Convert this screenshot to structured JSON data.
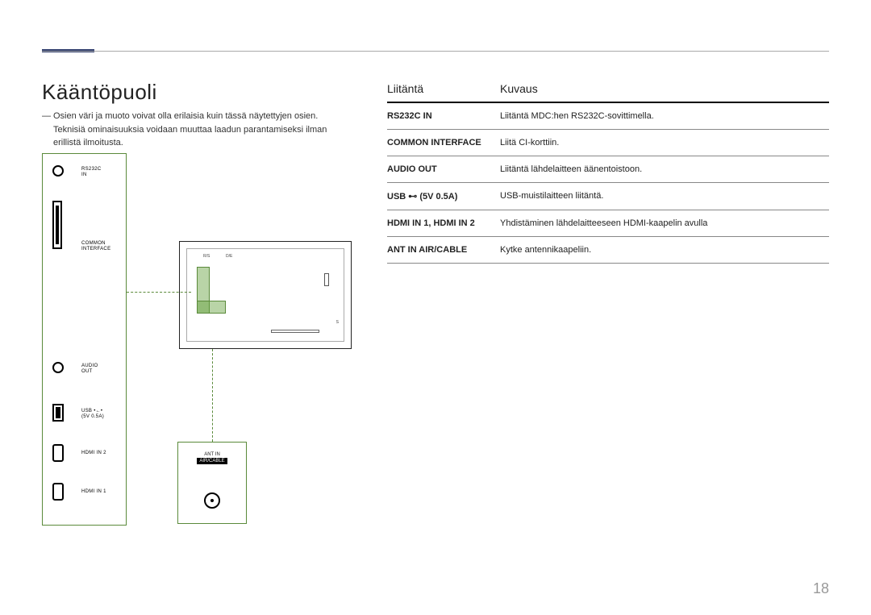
{
  "page_number": "18",
  "title": "Kääntöpuoli",
  "note_line1": "Osien väri ja muoto voivat olla erilaisia kuin tässä näytettyjen osien.",
  "note_line2": "Teknisiä ominaisuuksia voidaan muuttaa laadun parantamiseksi ilman erillistä ilmoitusta.",
  "port_labels": {
    "rs232c": "RS232C\nIN",
    "common": "COMMON\nINTERFACE",
    "audio": "AUDIO\nOUT",
    "usb": "USB •←•\n(5V 0.5A)",
    "hdmi2": "HDMI IN 2",
    "hdmi1": "HDMI IN 1"
  },
  "ant_label": "ANT IN",
  "ant_sub": "AIR/CABLE",
  "monitor_text": {
    "c1": "R/S",
    "c2": "D/E",
    "s": "S"
  },
  "table": {
    "col1": "Liitäntä",
    "col2": "Kuvaus",
    "rows": [
      {
        "name": "RS232C IN",
        "desc": "Liitäntä MDC:hen RS232C-sovittimella."
      },
      {
        "name": "COMMON INTERFACE",
        "desc": "Liitä CI-korttiin."
      },
      {
        "name": "AUDIO OUT",
        "desc": "Liitäntä lähdelaitteen äänentoistoon."
      },
      {
        "name": "USB ⊷ (5V 0.5A)",
        "desc": "USB-muistilaitteen liitäntä."
      },
      {
        "name": "HDMI IN 1, HDMI IN 2",
        "desc": "Yhdistäminen lähdelaitteeseen HDMI-kaapelin avulla"
      },
      {
        "name": "ANT IN AIR/CABLE",
        "desc": "Kytke antennikaapeliin."
      }
    ]
  }
}
